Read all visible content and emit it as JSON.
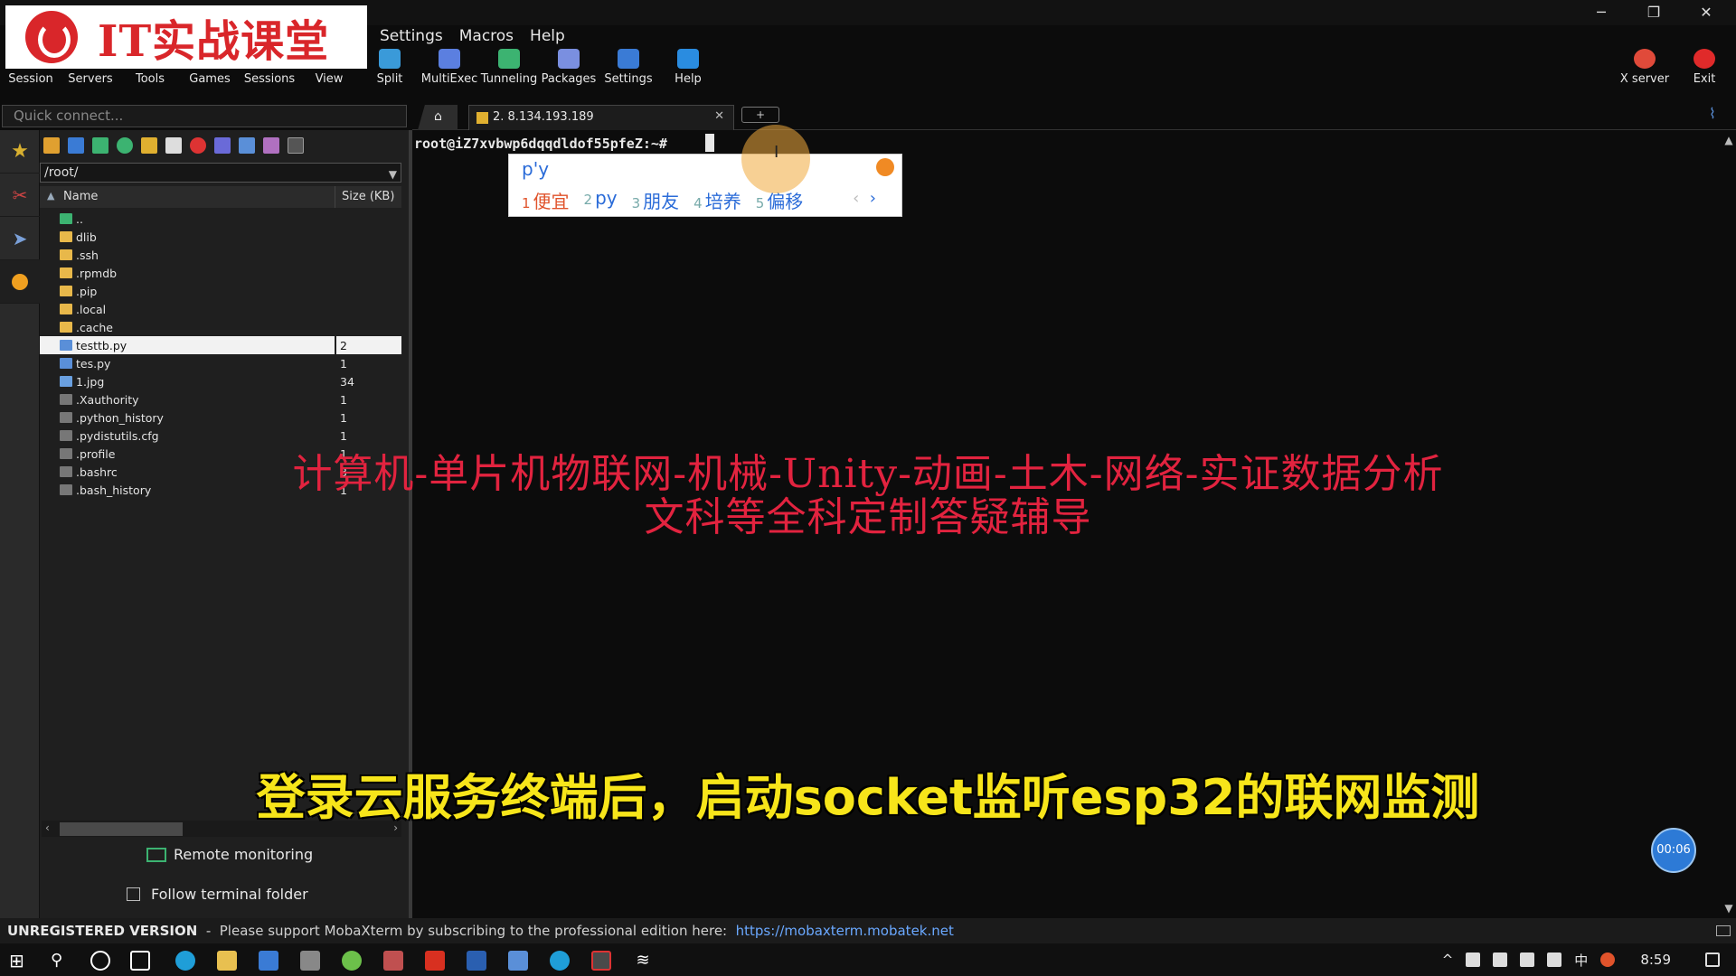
{
  "logo": {
    "text": "IT实战课堂"
  },
  "menu": [
    "Settings",
    "Macros",
    "Help"
  ],
  "toolbar": [
    {
      "label": "Session",
      "icon": "session-icon",
      "color": "#3a7bd5"
    },
    {
      "label": "Servers",
      "icon": "servers-icon",
      "color": "#4caf50"
    },
    {
      "label": "Tools",
      "icon": "tools-icon",
      "color": "#e04a3a"
    },
    {
      "label": "Games",
      "icon": "games-icon",
      "color": "#8bc34a"
    },
    {
      "label": "Sessions",
      "icon": "sessions-star-icon",
      "color": "#f5c518"
    },
    {
      "label": "View",
      "icon": "view-icon",
      "color": "#4caf50"
    },
    {
      "label": "Split",
      "icon": "split-icon",
      "color": "#3a9ad9"
    },
    {
      "label": "MultiExec",
      "icon": "multiexec-icon",
      "color": "#5b7fe0"
    },
    {
      "label": "Tunneling",
      "icon": "tunneling-icon",
      "color": "#3cb371"
    },
    {
      "label": "Packages",
      "icon": "packages-icon",
      "color": "#7a8fe0"
    },
    {
      "label": "Settings",
      "icon": "settings-gear-icon",
      "color": "#3a7bd5"
    },
    {
      "label": "Help",
      "icon": "help-icon",
      "color": "#2a8ce0"
    }
  ],
  "toolbar_right": [
    {
      "label": "X server",
      "icon": "x-server-icon",
      "color": "#e04a3a"
    },
    {
      "label": "Exit",
      "icon": "exit-power-icon",
      "color": "#e02a2a"
    }
  ],
  "quick_connect": {
    "placeholder": "Quick connect..."
  },
  "sftp": {
    "path": "/root/",
    "columns": {
      "name": "Name",
      "size": "Size (KB)"
    },
    "files": [
      {
        "name": "..",
        "size": "",
        "type": "parent"
      },
      {
        "name": "dlib",
        "size": "",
        "type": "folder"
      },
      {
        "name": ".ssh",
        "size": "",
        "type": "folder"
      },
      {
        "name": ".rpmdb",
        "size": "",
        "type": "folder"
      },
      {
        "name": ".pip",
        "size": "",
        "type": "folder"
      },
      {
        "name": ".local",
        "size": "",
        "type": "folder"
      },
      {
        "name": ".cache",
        "size": "",
        "type": "folder"
      },
      {
        "name": "testtb.py",
        "size": "2",
        "type": "python",
        "selected": true
      },
      {
        "name": "tes.py",
        "size": "1",
        "type": "python"
      },
      {
        "name": "1.jpg",
        "size": "34",
        "type": "image"
      },
      {
        "name": ".Xauthority",
        "size": "1",
        "type": "file"
      },
      {
        "name": ".python_history",
        "size": "1",
        "type": "file"
      },
      {
        "name": ".pydistutils.cfg",
        "size": "1",
        "type": "file"
      },
      {
        "name": ".profile",
        "size": "1",
        "type": "file"
      },
      {
        "name": ".bashrc",
        "size": "3",
        "type": "file"
      },
      {
        "name": ".bash_history",
        "size": "1",
        "type": "file"
      }
    ],
    "remote_monitoring": "Remote monitoring",
    "follow_folder": "Follow terminal folder"
  },
  "terminal": {
    "tab_label": "2. 8.134.193.189",
    "prompt": "root@iZ7xvbwp6dqqdldof55pfeZ:~#"
  },
  "ime": {
    "composition": "p'y",
    "candidates": [
      {
        "n": "1",
        "text": "便宜"
      },
      {
        "n": "2",
        "text": "py"
      },
      {
        "n": "3",
        "text": "朋友"
      },
      {
        "n": "4",
        "text": "培养"
      },
      {
        "n": "5",
        "text": "偏移"
      }
    ]
  },
  "overlay": {
    "watermark_line1": "计算机-单片机物联网-机械-Unity-动画-土木-网络-实证数据分析",
    "watermark_line2": "文科等全科定制答疑辅导",
    "subtitle": "登录云服务终端后，启动socket监听esp32的联网监测",
    "timer": "00:06"
  },
  "status": {
    "unregistered": "UNREGISTERED VERSION",
    "message": "  -  Please support MobaXterm by subscribing to the professional edition here:  ",
    "link": "https://mobaxterm.mobatek.net"
  },
  "taskbar": {
    "tray_ime": "中",
    "clock": "8:59"
  }
}
